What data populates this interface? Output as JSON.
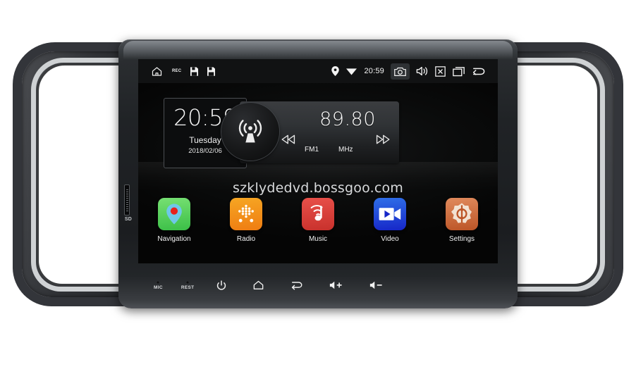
{
  "device": {
    "type": "car-head-unit",
    "trim_color": "#33353a",
    "accent_chrome": "#cfd2d4",
    "bezel_color": "#202326",
    "screen_bg": "#000000"
  },
  "side_slot": {
    "label": "SD",
    "name": "sd-card-slot"
  },
  "status_bar": {
    "left_icons": [
      {
        "name": "home-icon",
        "glyph": "home"
      },
      {
        "name": "rec-label",
        "glyph": "text",
        "text": "REC"
      },
      {
        "name": "save-icon-1",
        "glyph": "floppy"
      },
      {
        "name": "save-icon-2",
        "glyph": "floppy"
      }
    ],
    "right_icons": [
      {
        "name": "location-icon",
        "glyph": "pin"
      },
      {
        "name": "wifi-icon",
        "glyph": "wifi"
      }
    ],
    "time": "20:59",
    "nav_icons": [
      {
        "name": "screenshot-camera-icon",
        "glyph": "camera",
        "pressed": true
      },
      {
        "name": "volume-icon",
        "glyph": "speaker",
        "pressed": false
      },
      {
        "name": "mute-icon",
        "glyph": "x-box",
        "pressed": false
      },
      {
        "name": "recent-apps-icon",
        "glyph": "recents",
        "pressed": false
      },
      {
        "name": "back-icon",
        "glyph": "back",
        "pressed": false
      }
    ]
  },
  "clock_widget": {
    "time": "20:59",
    "weekday": "Tuesday",
    "date": "2018/02/06"
  },
  "radio_widget": {
    "frequency": "89.80",
    "band": "FM1",
    "unit": "MHz",
    "tower_icon": "radio-tower-icon",
    "prev_label": "prev-station",
    "next_label": "next-station"
  },
  "watermark": {
    "text": "szklydedvd.bossgoo.com"
  },
  "apps": [
    {
      "label": "Navigation",
      "icon": "map-pin-icon",
      "color": "#3bbf47",
      "tile_class": "tile-nav"
    },
    {
      "label": "Radio",
      "icon": "dot-grid-icon",
      "color": "#ef7d12",
      "tile_class": "tile-radio"
    },
    {
      "label": "Music",
      "icon": "music-note-icon",
      "color": "#c8312c",
      "tile_class": "tile-music"
    },
    {
      "label": "Video",
      "icon": "video-cam-icon",
      "color": "#1626c8",
      "tile_class": "tile-video"
    },
    {
      "label": "Settings",
      "icon": "gear-icon",
      "color": "#bc5527",
      "tile_class": "tile-settings"
    }
  ],
  "hardware_buttons": {
    "mic_label": "MIC",
    "reset_label": "REST",
    "buttons": [
      {
        "name": "power-button",
        "glyph": "power"
      },
      {
        "name": "home-button",
        "glyph": "home"
      },
      {
        "name": "back-button",
        "glyph": "back"
      },
      {
        "name": "volume-up-button",
        "glyph": "vol-plus"
      },
      {
        "name": "volume-down-button",
        "glyph": "vol-minus"
      }
    ]
  }
}
